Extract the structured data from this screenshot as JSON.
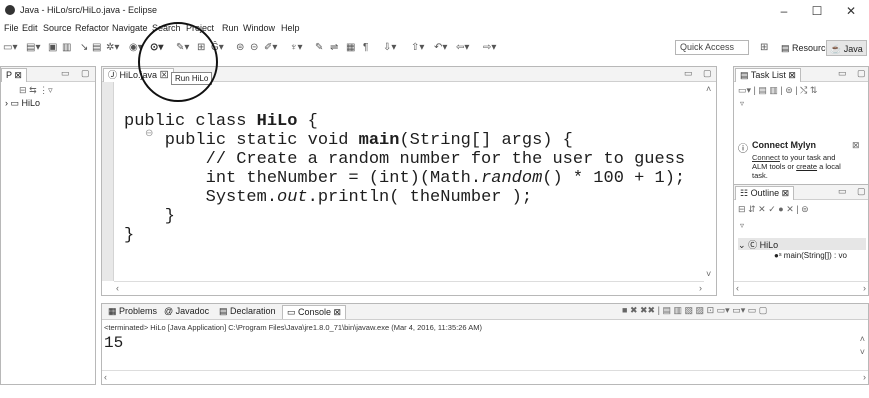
{
  "window": {
    "title": "Java - HiLo/src/HiLo.java - Eclipse",
    "minimize": "–",
    "maximize": "☐",
    "close": "✕"
  },
  "menu": [
    "File",
    "Edit",
    "Source",
    "Refactor",
    "Navigate",
    "Search",
    "Project",
    "Run",
    "Window",
    "Help"
  ],
  "toolbar": {
    "quick_access": "Quick Access",
    "resource": "Resource",
    "java": "Java"
  },
  "package_explorer": {
    "tab": "P ⊠",
    "project": "HiLo"
  },
  "editor": {
    "tab": "HiLo.java",
    "tab_close": "⊠",
    "tooltip": "Run HiLo",
    "code": {
      "l1_kw": "public class ",
      "l1_name": "HiLo",
      "l1_brace": " {",
      "l2_kw": "    public static void ",
      "l2_name": "main",
      "l2_rest": "(String[] args) {",
      "l3": "        // Create a random number for the user to guess",
      "l4_a": "        int theNumber = (int)(Math.",
      "l4_b": "random",
      "l4_c": "() * 100 + 1);",
      "l5_a": "        System.",
      "l5_b": "out",
      "l5_c": ".println( theNumber );",
      "l6": "    }",
      "l7": "}"
    }
  },
  "task_list": {
    "tab": "Task List ⊠"
  },
  "mylyn": {
    "title": "Connect Mylyn",
    "close": "⊠",
    "line1_link": "Connect",
    "line1_rest": " to your task and",
    "line2_a": "ALM tools or ",
    "line2_link": "create",
    "line2_b": " a local",
    "line3": "task."
  },
  "outline": {
    "tab": "Outline ⊠",
    "class": "HiLo",
    "method": "main(String[]) : vo"
  },
  "bottom": {
    "tabs": [
      "Problems",
      "Javadoc",
      "Declaration",
      "Console ⊠"
    ],
    "status": "<terminated> HiLo [Java Application] C:\\Program Files\\Java\\jre1.8.0_71\\bin\\javaw.exe (Mar 4, 2016, 11:35:26 AM)",
    "output": "15"
  }
}
